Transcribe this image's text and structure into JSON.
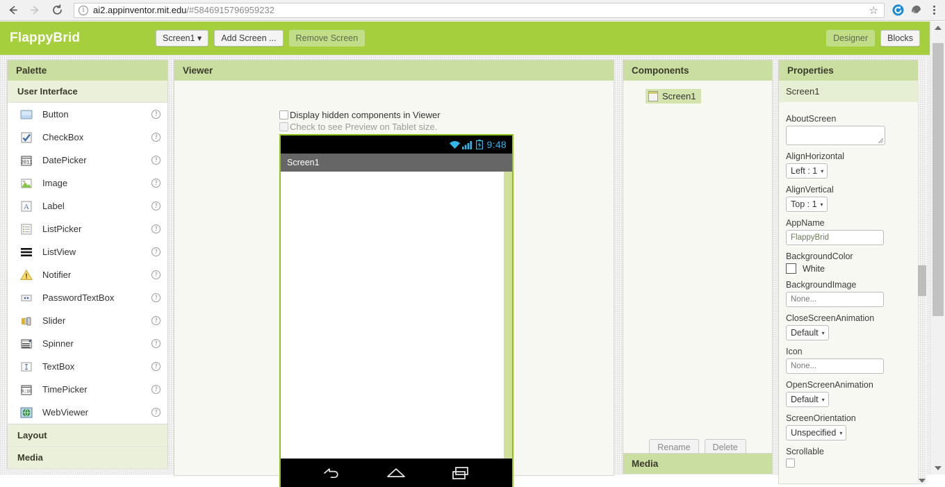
{
  "browser": {
    "back_icon": "back-arrow-icon",
    "forward_icon": "forward-arrow-icon",
    "reload_icon": "reload-icon",
    "info_icon": "i",
    "url_domain": "ai2.appinventor.mit.edu",
    "url_path": "/#5846915796959232",
    "star_icon": "☆",
    "extension_icons": [
      "sync-extension-icon",
      "ghostery-extension-icon"
    ],
    "menu_icon": "three-dots-menu-icon"
  },
  "header": {
    "project_title": "FlappyBrid",
    "screen_selector": "Screen1",
    "screen_selector_caret": "▾",
    "add_screen": "Add Screen ...",
    "remove_screen": "Remove Screen",
    "designer": "Designer",
    "blocks": "Blocks",
    "bar_color": "#a5cf3d"
  },
  "palette": {
    "title": "Palette",
    "sections": [
      {
        "name": "User Interface",
        "expanded": true
      },
      {
        "name": "Layout",
        "expanded": false
      },
      {
        "name": "Media",
        "expanded": false
      }
    ],
    "help_glyph": "?",
    "items": [
      {
        "label": "Button",
        "icon": "button-component-icon"
      },
      {
        "label": "CheckBox",
        "icon": "checkbox-component-icon"
      },
      {
        "label": "DatePicker",
        "icon": "datepicker-component-icon"
      },
      {
        "label": "Image",
        "icon": "image-component-icon"
      },
      {
        "label": "Label",
        "icon": "label-component-icon"
      },
      {
        "label": "ListPicker",
        "icon": "listpicker-component-icon"
      },
      {
        "label": "ListView",
        "icon": "listview-component-icon"
      },
      {
        "label": "Notifier",
        "icon": "notifier-component-icon"
      },
      {
        "label": "PasswordTextBox",
        "icon": "passwordtextbox-component-icon"
      },
      {
        "label": "Slider",
        "icon": "slider-component-icon"
      },
      {
        "label": "Spinner",
        "icon": "spinner-component-icon"
      },
      {
        "label": "TextBox",
        "icon": "textbox-component-icon"
      },
      {
        "label": "TimePicker",
        "icon": "timepicker-component-icon"
      },
      {
        "label": "WebViewer",
        "icon": "webviewer-component-icon"
      }
    ]
  },
  "viewer": {
    "title": "Viewer",
    "display_hidden_label": "Display hidden components in Viewer",
    "display_hidden_checked": false,
    "tablet_preview_label": "Check to see Preview on Tablet size.",
    "tablet_preview_checked": false,
    "phone": {
      "status_time": "9:48",
      "status_icons": [
        "wifi-icon",
        "signal-icon",
        "battery-charging-icon"
      ],
      "status_color": "#33b5e5",
      "title": "Screen1",
      "nav_icons": [
        "back-nav-icon",
        "home-nav-icon",
        "recents-nav-icon"
      ],
      "frame_color": "#8fc31f"
    }
  },
  "components": {
    "title": "Components",
    "tree": [
      {
        "label": "Screen1",
        "selected": true,
        "icon": "screen-component-icon"
      }
    ],
    "rename_button": "Rename",
    "delete_button": "Delete"
  },
  "media": {
    "title": "Media"
  },
  "properties": {
    "title": "Properties",
    "selected_component": "Screen1",
    "fields": [
      {
        "label": "AboutScreen",
        "type": "textarea",
        "value": ""
      },
      {
        "label": "AlignHorizontal",
        "type": "select",
        "value": "Left : 1"
      },
      {
        "label": "AlignVertical",
        "type": "select",
        "value": "Top : 1"
      },
      {
        "label": "AppName",
        "type": "input",
        "value": "FlappyBrid"
      },
      {
        "label": "BackgroundColor",
        "type": "color",
        "value": "White",
        "swatch": "#ffffff"
      },
      {
        "label": "BackgroundImage",
        "type": "input",
        "value": "None..."
      },
      {
        "label": "CloseScreenAnimation",
        "type": "select",
        "value": "Default"
      },
      {
        "label": "Icon",
        "type": "input",
        "value": "None..."
      },
      {
        "label": "OpenScreenAnimation",
        "type": "select",
        "value": "Default"
      },
      {
        "label": "ScreenOrientation",
        "type": "select",
        "value": "Unspecified"
      },
      {
        "label": "Scrollable",
        "type": "checkbox",
        "value": ""
      }
    ],
    "caret": "▾"
  }
}
